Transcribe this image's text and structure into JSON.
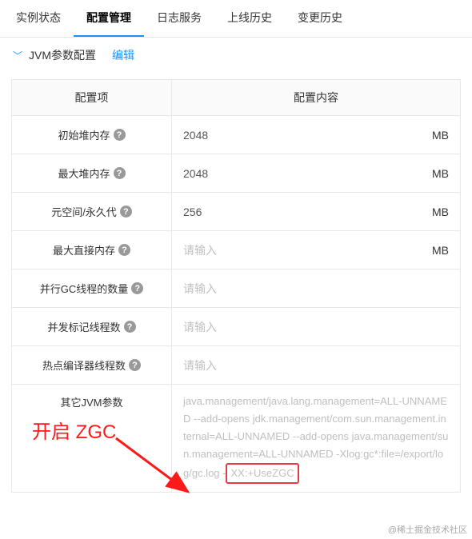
{
  "tabs": [
    "实例状态",
    "配置管理",
    "日志服务",
    "上线历史",
    "变更历史"
  ],
  "activeTab": 1,
  "panel": {
    "title": "JVM参数配置",
    "editLabel": "编辑"
  },
  "tableHeader": {
    "label": "配置项",
    "content": "配置内容"
  },
  "rows": [
    {
      "label": "初始堆内存",
      "help": true,
      "value": "2048",
      "placeholder": "",
      "unit": "MB"
    },
    {
      "label": "最大堆内存",
      "help": true,
      "value": "2048",
      "placeholder": "",
      "unit": "MB"
    },
    {
      "label": "元空间/永久代",
      "help": true,
      "value": "256",
      "placeholder": "",
      "unit": "MB"
    },
    {
      "label": "最大直接内存",
      "help": true,
      "value": "",
      "placeholder": "请输入",
      "unit": "MB"
    },
    {
      "label": "并行GC线程的数量",
      "help": true,
      "value": "",
      "placeholder": "请输入",
      "unit": ""
    },
    {
      "label": "并发标记线程数",
      "help": true,
      "value": "",
      "placeholder": "请输入",
      "unit": ""
    },
    {
      "label": "热点编译器线程数",
      "help": true,
      "value": "",
      "placeholder": "请输入",
      "unit": ""
    }
  ],
  "otherParams": {
    "label": "其它JVM参数",
    "textPrefix": "java.management/java.lang.management=ALL-UNNAMED --add-opens jdk.management/com.sun.management.internal=ALL-UNNAMED --add-opens java.management/sun.management=ALL-UNNAMED -Xlog:gc*:file=/export/log/gc.log -",
    "highlighted": "XX:+UseZGC"
  },
  "annotation": "开启 ZGC",
  "watermark": "@稀土掘金技术社区"
}
